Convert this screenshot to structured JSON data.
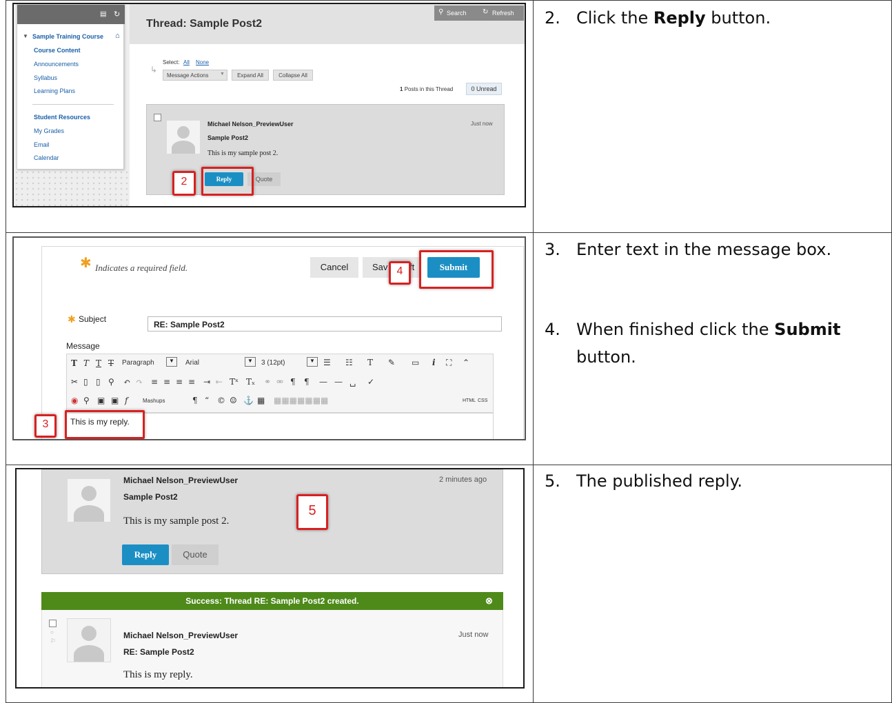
{
  "steps": [
    {
      "num": "2.",
      "pre": "Click the ",
      "bold": "Reply",
      "post": " button."
    },
    {
      "num": "3.",
      "pre": "Enter text in the message box.",
      "bold": "",
      "post": ""
    },
    {
      "num": "4.",
      "pre": "When finished click the ",
      "bold": "Submit",
      "post": "",
      "line2": "button."
    },
    {
      "num": "5.",
      "pre": "The published reply.",
      "bold": "",
      "post": ""
    }
  ],
  "shot1": {
    "sidebar": {
      "course": "Sample Training Course",
      "items": [
        "Course Content",
        "Announcements",
        "Syllabus",
        "Learning Plans"
      ],
      "section2": "Student Resources",
      "items2": [
        "My Grades",
        "Email",
        "Calendar"
      ]
    },
    "search": "Search",
    "refresh": "Refresh",
    "title": "Thread: Sample Post2",
    "select_label": "Select:",
    "select_all": "All",
    "select_none": "None",
    "message_actions": "Message Actions",
    "expand_all": "Expand All",
    "collapse_all": "Collapse All",
    "posts_count": "1",
    "posts_label": "Posts in this Thread",
    "unread": "0 Unread",
    "post": {
      "author": "Michael Nelson_PreviewUser",
      "subject": "Sample Post2",
      "time": "Just now",
      "body": "This is my sample post 2."
    },
    "reply": "Reply",
    "quote": "Quote",
    "callout": "2"
  },
  "shot2": {
    "required_note": "Indicates a required field.",
    "cancel": "Cancel",
    "save_draft_a": "Sav",
    "save_draft_b": "ft",
    "submit": "Submit",
    "callout_submit": "4",
    "subject_label": "Subject",
    "subject_value": "RE: Sample Post2",
    "message_label": "Message",
    "toolbar": {
      "paragraph": "Paragraph",
      "font": "Arial",
      "size": "3 (12pt)",
      "mashups": "Mashups",
      "html": "HTML",
      "css": "CSS"
    },
    "reply_text": "This is my reply.",
    "callout_text": "3"
  },
  "shot3": {
    "post1": {
      "author": "Michael Nelson_PreviewUser",
      "subject": "Sample Post2",
      "time": "2 minutes ago",
      "body": "This is my sample post 2."
    },
    "reply": "Reply",
    "quote": "Quote",
    "callout": "5",
    "success": "Success: Thread RE: Sample Post2 created.",
    "post2": {
      "author": "Michael Nelson_PreviewUser",
      "subject": "RE: Sample Post2",
      "time": "Just now",
      "body": "This is my reply."
    }
  }
}
